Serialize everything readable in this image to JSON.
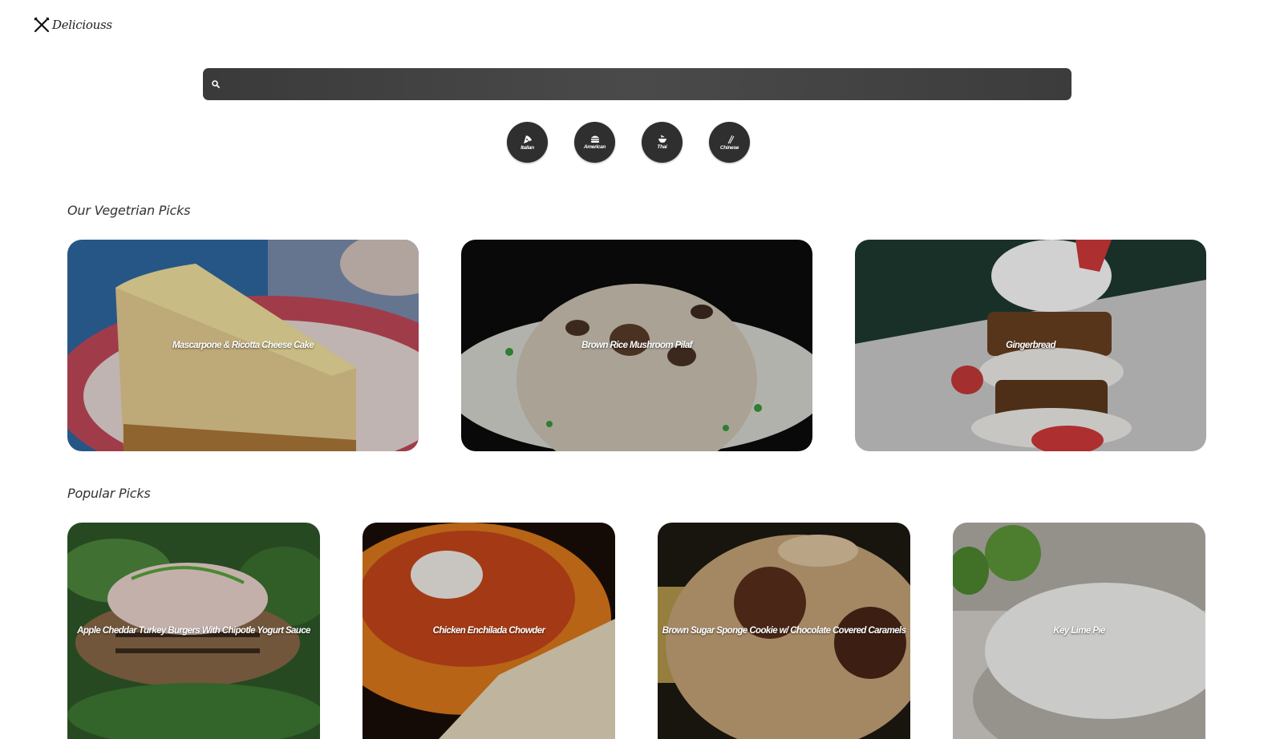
{
  "brand": {
    "name": "Deliciouss",
    "logo_icon": "crossed-utensils-icon"
  },
  "search": {
    "placeholder": "",
    "value": "",
    "icon": "search-icon"
  },
  "categories": [
    {
      "label": "Italian",
      "icon": "pizza-icon"
    },
    {
      "label": "American",
      "icon": "burger-icon"
    },
    {
      "label": "Thai",
      "icon": "bowl-icon"
    },
    {
      "label": "Chinese",
      "icon": "chopsticks-icon"
    }
  ],
  "sections": {
    "vegetarian": {
      "title": "Our Vegetrian Picks",
      "items": [
        {
          "title": "Mascarpone & Ricotta Cheese Cake"
        },
        {
          "title": "Brown Rice Mushroom Pilaf"
        },
        {
          "title": "Gingerbread"
        }
      ]
    },
    "popular": {
      "title": "Popular Picks",
      "items": [
        {
          "title": "Apple Cheddar Turkey Burgers With Chipotle Yogurt Sauce"
        },
        {
          "title": "Chicken Enchilada Chowder"
        },
        {
          "title": "Brown Sugar Sponge Cookie w/ Chocolate Covered Caramels"
        },
        {
          "title": "Key Lime Pie"
        }
      ]
    }
  }
}
